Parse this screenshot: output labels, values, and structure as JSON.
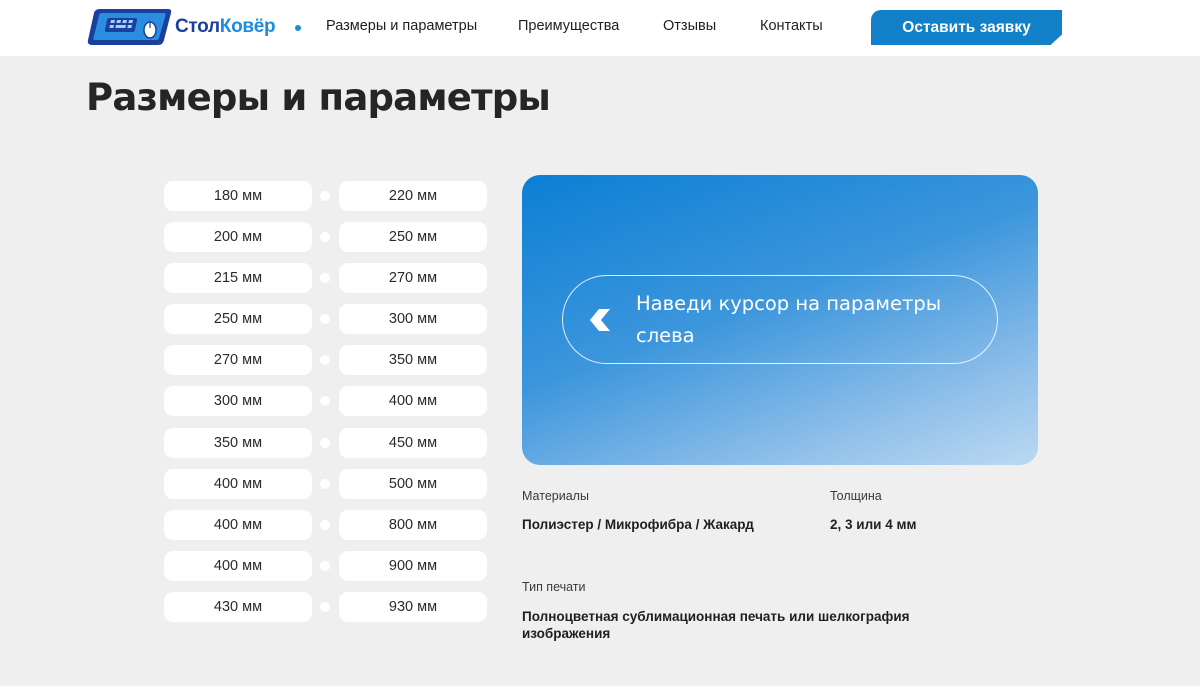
{
  "header": {
    "logo": {
      "part1": "Стол",
      "part2": "Ковёр"
    },
    "nav": [
      "Размеры и параметры",
      "Преимущества",
      "Отзывы",
      "Контакты"
    ],
    "cta_label": "Оставить заявку"
  },
  "page_title": "Размеры и параметры",
  "sizes": {
    "left": [
      "180 мм",
      "200 мм",
      "215 мм",
      "250 мм",
      "270 мм",
      "300 мм",
      "350 мм",
      "400 мм",
      "400 мм",
      "400 мм",
      "430 мм"
    ],
    "right": [
      "220 мм",
      "250 мм",
      "270 мм",
      "300 мм",
      "350 мм",
      "400 мм",
      "450 мм",
      "500 мм",
      "800 мм",
      "900 мм",
      "930 мм"
    ]
  },
  "preview": {
    "hint_text": "Наведи курсор на параметры слева",
    "icon": "chevron-left-icon"
  },
  "specs": {
    "materials": {
      "label": "Материалы",
      "value": "Полиэстер / Микрофибра / Жакард"
    },
    "thickness": {
      "label": "Толщина",
      "value": "2, 3 или 4 мм"
    },
    "print": {
      "label": "Тип печати",
      "value": "Полноцветная сублимационная печать или шелкография изображения"
    }
  },
  "colors": {
    "accent": "#1180c9",
    "brand_dark": "#1b3f9c",
    "brand_light": "#1d8be0",
    "background": "#efefef"
  }
}
